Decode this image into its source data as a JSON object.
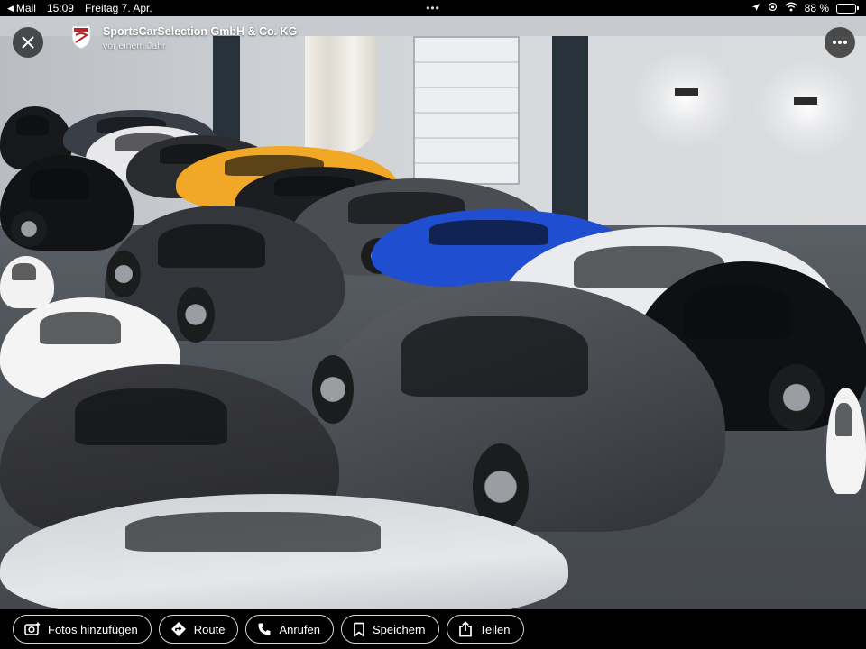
{
  "status_bar": {
    "back_app": "Mail",
    "time": "15:09",
    "date": "Freitag 7. Apr.",
    "multitask_dots": "•••",
    "battery_percent": "88 %",
    "battery_level": 0.88,
    "battery_color": "#34c759"
  },
  "header": {
    "close_icon": "close-icon",
    "poster_name": "SportsCarSelection GmbH & Co. KG",
    "posted_time": "vor einem Jahr",
    "more_icon": "more-icon"
  },
  "photo": {
    "subject": "showroom-photo"
  },
  "actions": [
    {
      "label": "Fotos hinzufügen",
      "icon": "add-photo-icon"
    },
    {
      "label": "Route",
      "icon": "directions-icon"
    },
    {
      "label": "Anrufen",
      "icon": "phone-icon"
    },
    {
      "label": "Speichern",
      "icon": "bookmark-icon"
    },
    {
      "label": "Teilen",
      "icon": "share-icon"
    }
  ]
}
